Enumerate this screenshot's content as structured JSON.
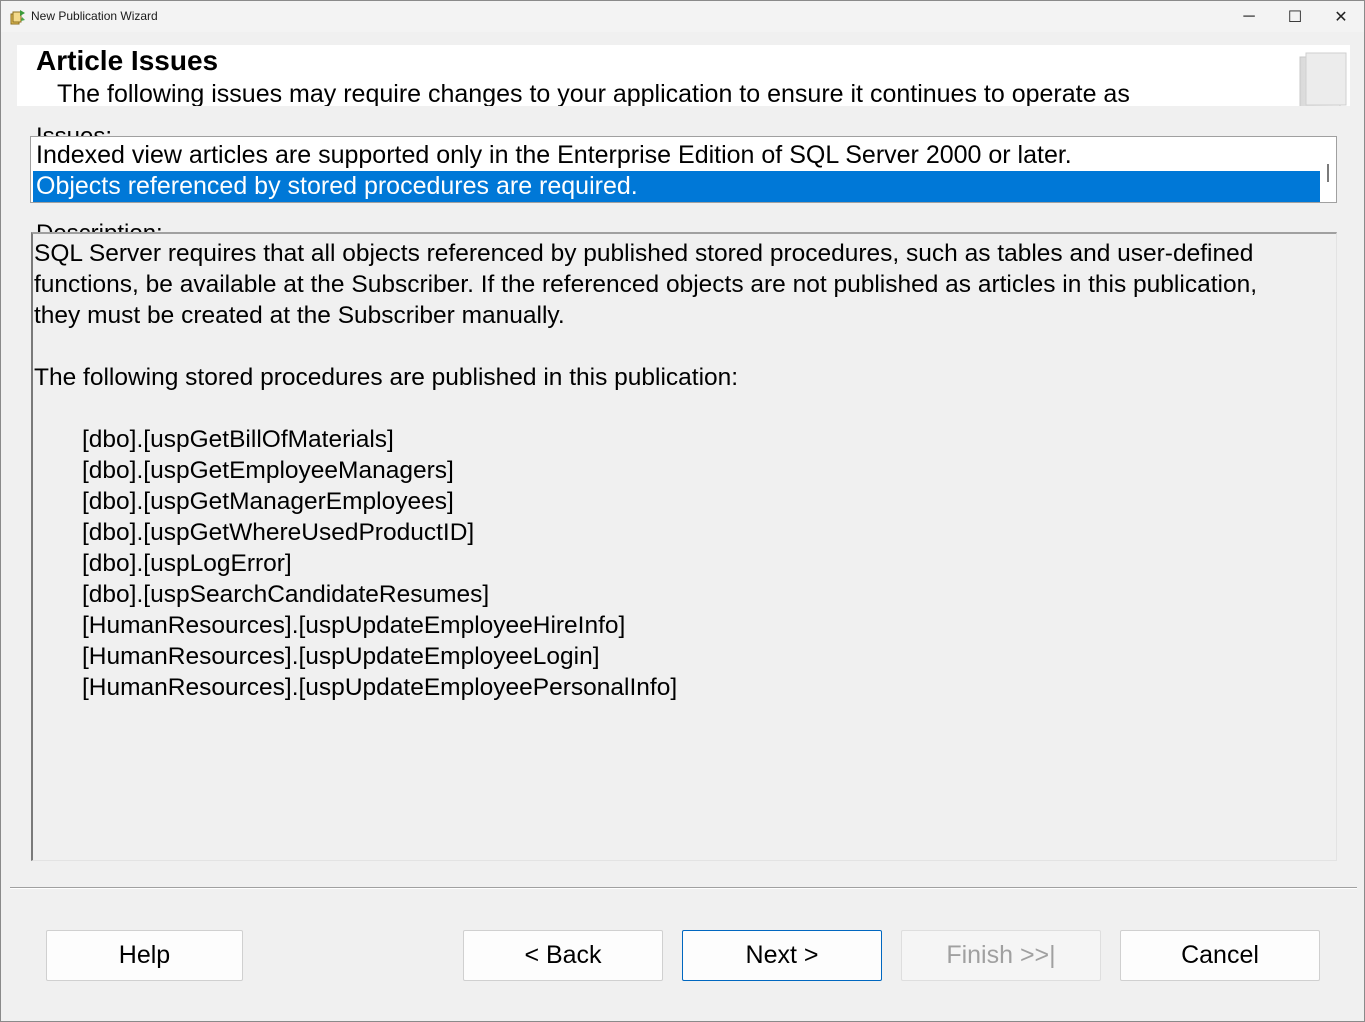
{
  "window": {
    "title": "New Publication Wizard",
    "icon": "wizard-app-icon",
    "controls": {
      "minimize": "─",
      "maximize": "☐",
      "close": "✕"
    }
  },
  "header": {
    "title": "Article Issues",
    "subtitle": "The following issues may require changes to your application to ensure it continues to operate as"
  },
  "issues": {
    "label": "Issues:",
    "items": [
      {
        "text": "Indexed view articles are supported only in the Enterprise Edition of SQL Server 2000 or later.",
        "selected": false
      },
      {
        "text": "Objects referenced by stored procedures are required.",
        "selected": true
      }
    ]
  },
  "description": {
    "label": "Description:",
    "paragraph1": "SQL Server requires that all objects referenced by published stored procedures, such as tables and user-defined functions, be available at the Subscriber. If the referenced objects are not published as articles in this publication, they must be created at the Subscriber manually.",
    "paragraph2": "The following stored procedures are published in this publication:",
    "procedures": [
      "[dbo].[uspGetBillOfMaterials]",
      "[dbo].[uspGetEmployeeManagers]",
      "[dbo].[uspGetManagerEmployees]",
      "[dbo].[uspGetWhereUsedProductID]",
      "[dbo].[uspLogError]",
      "[dbo].[uspSearchCandidateResumes]",
      "[HumanResources].[uspUpdateEmployeeHireInfo]",
      "[HumanResources].[uspUpdateEmployeeLogin]",
      "[HumanResources].[uspUpdateEmployeePersonalInfo]"
    ]
  },
  "buttons": {
    "help": "Help",
    "back": "< Back",
    "next": "Next >",
    "finish": "Finish >>|",
    "cancel": "Cancel"
  },
  "colors": {
    "selection": "#0078d7",
    "default_button_border": "#0067c0",
    "disabled_text": "#a0a0a0"
  }
}
